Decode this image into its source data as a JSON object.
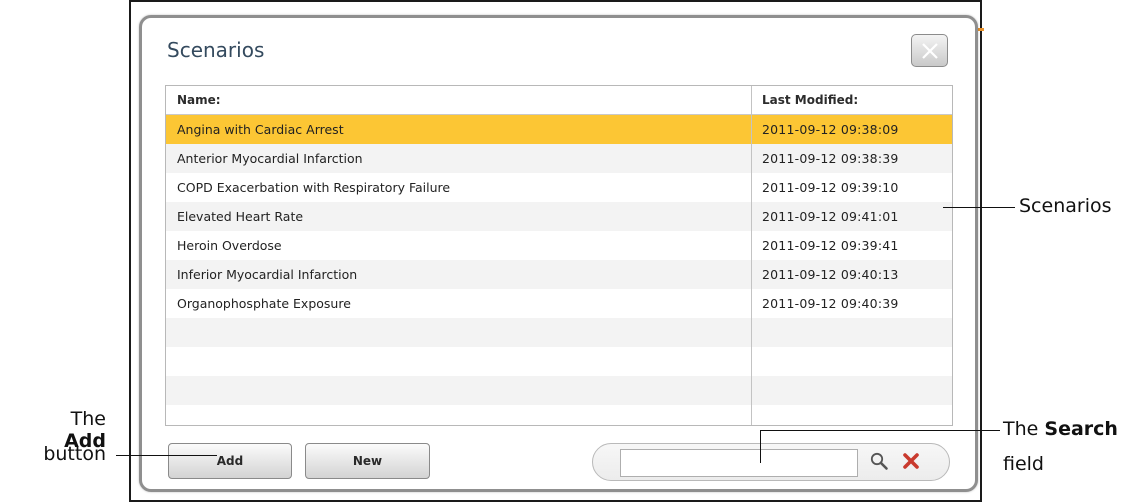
{
  "dialog": {
    "title": "Scenarios",
    "close_label": "Close"
  },
  "table": {
    "columns": [
      "Name:",
      "Last Modified:"
    ],
    "rows": [
      {
        "name": "Angina with Cardiac Arrest",
        "modified": "2011-09-12 09:38:09",
        "selected": true
      },
      {
        "name": "Anterior Myocardial Infarction",
        "modified": "2011-09-12 09:38:39",
        "selected": false
      },
      {
        "name": "COPD Exacerbation with Respiratory Failure",
        "modified": "2011-09-12 09:39:10",
        "selected": false
      },
      {
        "name": "Elevated Heart Rate",
        "modified": "2011-09-12 09:41:01",
        "selected": false
      },
      {
        "name": "Heroin Overdose",
        "modified": "2011-09-12 09:39:41",
        "selected": false
      },
      {
        "name": "Inferior Myocardial Infarction",
        "modified": "2011-09-12 09:40:13",
        "selected": false
      },
      {
        "name": "Organophosphate Exposure",
        "modified": "2011-09-12 09:40:39",
        "selected": false
      }
    ],
    "empty_rows": 4
  },
  "buttons": {
    "add": "Add",
    "new": "New"
  },
  "search": {
    "value": "",
    "placeholder": ""
  },
  "callouts": {
    "scenarios": "Scenarios",
    "add_prefix": "The",
    "add_bold": "Add",
    "add_suffix": "button",
    "search_prefix": "The",
    "search_bold": "Search",
    "search_suffix": "field"
  },
  "colors": {
    "selected_row": "#fcc634",
    "title": "#344a5e",
    "clear_icon": "#c93a2e"
  }
}
